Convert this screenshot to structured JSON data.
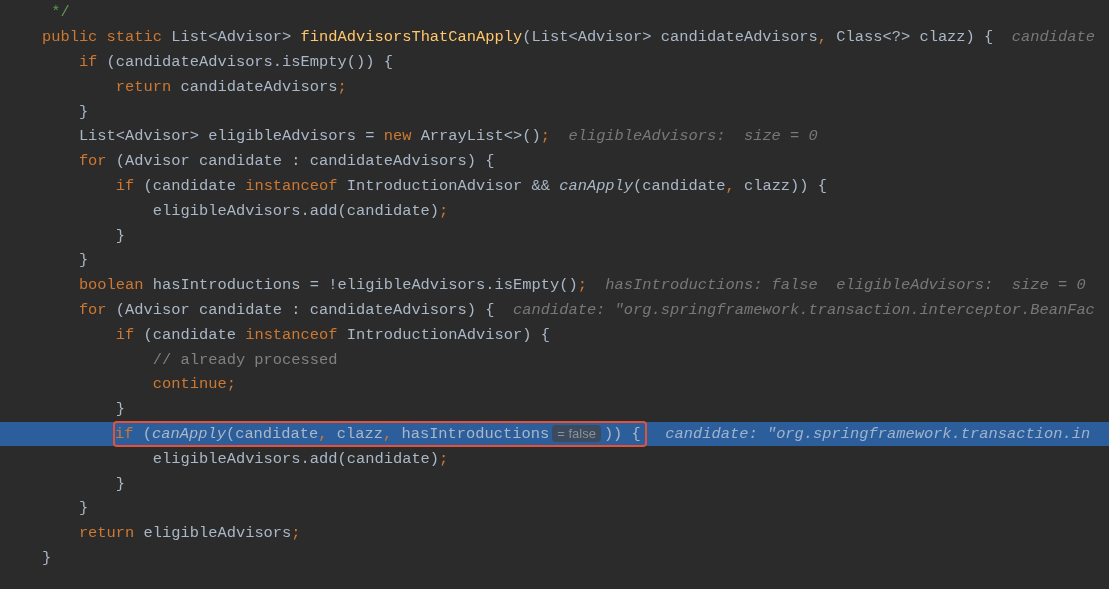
{
  "editor": {
    "lines": [
      {
        "tokens": [
          {
            "kind": "doc",
            "text": "     */"
          }
        ],
        "selected": false
      },
      {
        "tokens": [
          {
            "kind": "kw",
            "text": "    public static "
          },
          {
            "kind": "id",
            "text": "List<Advisor> "
          },
          {
            "kind": "fn",
            "text": "findAdvisorsThatCanApply"
          },
          {
            "kind": "id",
            "text": "(List<Advisor> candidateAdvisors"
          },
          {
            "kind": "kw",
            "text": ","
          },
          {
            "kind": "id",
            "text": " Class<?> clazz) {"
          }
        ],
        "hints": [
          "candidate"
        ],
        "selected": false
      },
      {
        "tokens": [
          {
            "kind": "kw",
            "text": "        if"
          },
          {
            "kind": "id",
            "text": " (candidateAdvisors.isEmpty()) {"
          }
        ],
        "selected": false
      },
      {
        "tokens": [
          {
            "kind": "kw",
            "text": "            return"
          },
          {
            "kind": "id",
            "text": " candidateAdvisors"
          },
          {
            "kind": "kw",
            "text": ";"
          }
        ],
        "selected": false
      },
      {
        "tokens": [
          {
            "kind": "id",
            "text": "        }"
          }
        ],
        "selected": false
      },
      {
        "tokens": [
          {
            "kind": "id",
            "text": "        List<Advisor> eligibleAdvisors = "
          },
          {
            "kind": "kw",
            "text": "new"
          },
          {
            "kind": "id",
            "text": " ArrayList<>()"
          },
          {
            "kind": "kw",
            "text": ";"
          }
        ],
        "hints": [
          "eligibleAdvisors:  size = 0"
        ],
        "selected": false
      },
      {
        "tokens": [
          {
            "kind": "kw",
            "text": "        for"
          },
          {
            "kind": "id",
            "text": " (Advisor candidate : candidateAdvisors) {"
          }
        ],
        "selected": false
      },
      {
        "tokens": [
          {
            "kind": "kw",
            "text": "            if"
          },
          {
            "kind": "id",
            "text": " (candidate "
          },
          {
            "kind": "kw",
            "text": "instanceof"
          },
          {
            "kind": "id",
            "text": " IntroductionAdvisor && "
          },
          {
            "kind": "call",
            "text": "canApply"
          },
          {
            "kind": "id",
            "text": "(candidate"
          },
          {
            "kind": "kw",
            "text": ","
          },
          {
            "kind": "id",
            "text": " clazz)) {"
          }
        ],
        "selected": false
      },
      {
        "tokens": [
          {
            "kind": "id",
            "text": "                eligibleAdvisors.add(candidate)"
          },
          {
            "kind": "kw",
            "text": ";"
          }
        ],
        "selected": false
      },
      {
        "tokens": [
          {
            "kind": "id",
            "text": "            }"
          }
        ],
        "selected": false
      },
      {
        "tokens": [
          {
            "kind": "id",
            "text": "        }"
          }
        ],
        "selected": false
      },
      {
        "tokens": [
          {
            "kind": "kw",
            "text": "        boolean"
          },
          {
            "kind": "id",
            "text": " hasIntroductions = !eligibleAdvisors.isEmpty()"
          },
          {
            "kind": "kw",
            "text": ";"
          }
        ],
        "hints": [
          "hasIntroductions: false",
          "eligibleAdvisors:  size = 0"
        ],
        "selected": false
      },
      {
        "tokens": [
          {
            "kind": "kw",
            "text": "        for"
          },
          {
            "kind": "id",
            "text": " (Advisor candidate : candidateAdvisors) {"
          }
        ],
        "hints": [
          "candidate: \"org.springframework.transaction.interceptor.BeanFac"
        ],
        "selected": false
      },
      {
        "tokens": [
          {
            "kind": "kw",
            "text": "            if"
          },
          {
            "kind": "id",
            "text": " (candidate "
          },
          {
            "kind": "kw",
            "text": "instanceof"
          },
          {
            "kind": "id",
            "text": " IntroductionAdvisor) {"
          }
        ],
        "selected": false
      },
      {
        "tokens": [
          {
            "kind": "comment",
            "text": "                // already processed"
          }
        ],
        "selected": false
      },
      {
        "tokens": [
          {
            "kind": "kw",
            "text": "                continue;"
          }
        ],
        "selected": false
      },
      {
        "tokens": [
          {
            "kind": "id",
            "text": "            }"
          }
        ],
        "selected": false
      },
      {
        "tokens": [
          {
            "kind": "kw",
            "text": "if"
          },
          {
            "kind": "id",
            "text": " ("
          },
          {
            "kind": "call",
            "text": "canApply"
          },
          {
            "kind": "id",
            "text": "(candidate"
          },
          {
            "kind": "kw",
            "text": ","
          },
          {
            "kind": "id",
            "text": " clazz"
          },
          {
            "kind": "kw",
            "text": ","
          },
          {
            "kind": "id",
            "text": " hasIntroductions"
          }
        ],
        "badge": "= false",
        "tail": ")) {",
        "selected": true,
        "boxed": true,
        "hints": [
          "candidate: \"org.springframework.transaction.in"
        ]
      },
      {
        "tokens": [
          {
            "kind": "id",
            "text": "                eligibleAdvisors.add(candidate)"
          },
          {
            "kind": "kw",
            "text": ";"
          }
        ],
        "selected": false
      },
      {
        "tokens": [
          {
            "kind": "id",
            "text": "            }"
          }
        ],
        "selected": false
      },
      {
        "tokens": [
          {
            "kind": "id",
            "text": "        }"
          }
        ],
        "selected": false
      },
      {
        "tokens": [
          {
            "kind": "kw",
            "text": "        return"
          },
          {
            "kind": "id",
            "text": " eligibleAdvisors"
          },
          {
            "kind": "kw",
            "text": ";"
          }
        ],
        "selected": false
      },
      {
        "tokens": [
          {
            "kind": "id",
            "text": "    }"
          }
        ],
        "selected": false
      }
    ]
  }
}
